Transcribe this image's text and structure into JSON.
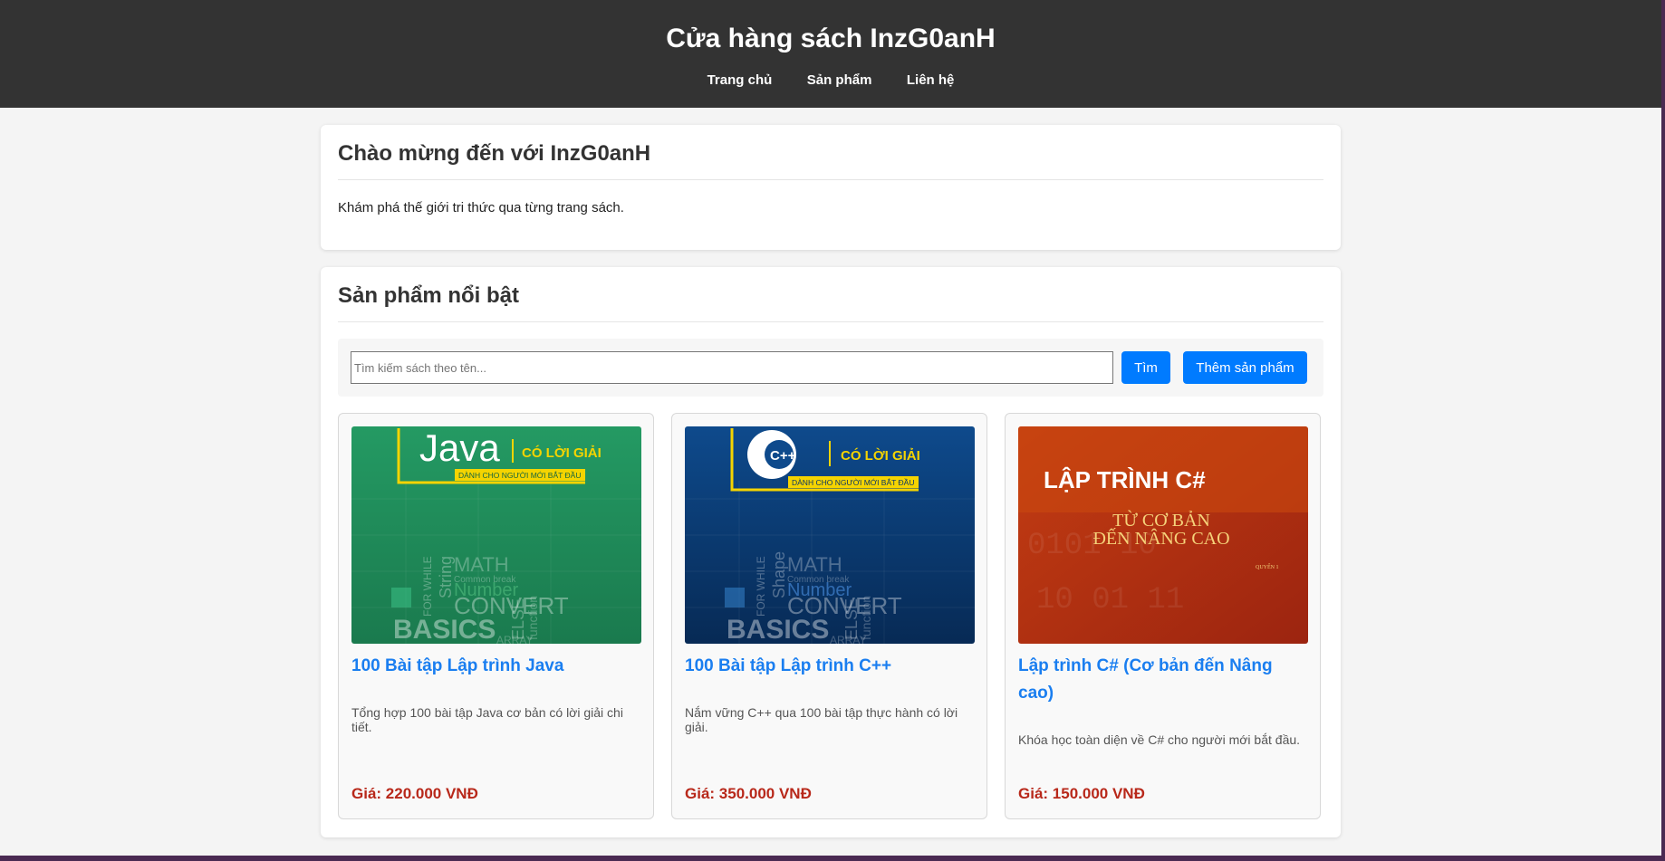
{
  "site": {
    "title": "Cửa hàng sách InzG0anH",
    "nav": [
      "Trang chủ",
      "Sản phẩm",
      "Liên hệ"
    ]
  },
  "welcome": {
    "heading": "Chào mừng đến với InzG0anH",
    "text": "Khám phá thế giới tri thức qua từng trang sách."
  },
  "featured": {
    "heading": "Sản phẩm nổi bật",
    "search_placeholder": "Tìm kiếm sách theo tên...",
    "search_button": "Tìm",
    "add_button": "Thêm sản phẩm"
  },
  "products": [
    {
      "title": "100 Bài tập Lập trình Java",
      "description": "Tổng hợp 100 bài tập Java cơ bản có lời giải chi tiết.",
      "price": "Giá: 220.000 VNĐ",
      "cover": {
        "color": "#1f8a5b",
        "brand": "Java",
        "tagline": "CÓ LỜI GIẢI",
        "subline": "DÀNH CHO NGƯỜI MỚI BẮT ĐẦU",
        "words": [
          "MATH",
          "Number",
          "CONVERT",
          "BASICS",
          "FOR WHILE",
          "String",
          "ELSE",
          "ARRAY",
          "function",
          "Common break"
        ]
      }
    },
    {
      "title": "100 Bài tập Lập trình C++",
      "description": "Nắm vững C++ qua 100 bài tập thực hành có lời giải.",
      "price": "Giá: 350.000 VNĐ",
      "cover": {
        "color": "#0c3c78",
        "brand": "C++",
        "tagline": "CÓ LỜI GIẢI",
        "subline": "DÀNH CHO NGƯỜI MỚI BẮT ĐẦU",
        "words": [
          "MATH",
          "Number",
          "CONVERT",
          "BASICS",
          "FOR WHILE",
          "Shape",
          "ELSE",
          "ARRAY",
          "function",
          "Common break"
        ]
      }
    },
    {
      "title": "Lập trình C# (Cơ bản đến Nâng cao)",
      "description": "Khóa học toàn diện về C# cho người mới bắt đầu.",
      "price": "Giá: 150.000 VNĐ",
      "cover": {
        "color": "#b8300f",
        "brand": "LẬP TRÌNH C#",
        "line1": "TỪ CƠ BẢN",
        "line2": "ĐẾN NÂNG CAO",
        "volume": "QUYỂN 1"
      }
    }
  ]
}
